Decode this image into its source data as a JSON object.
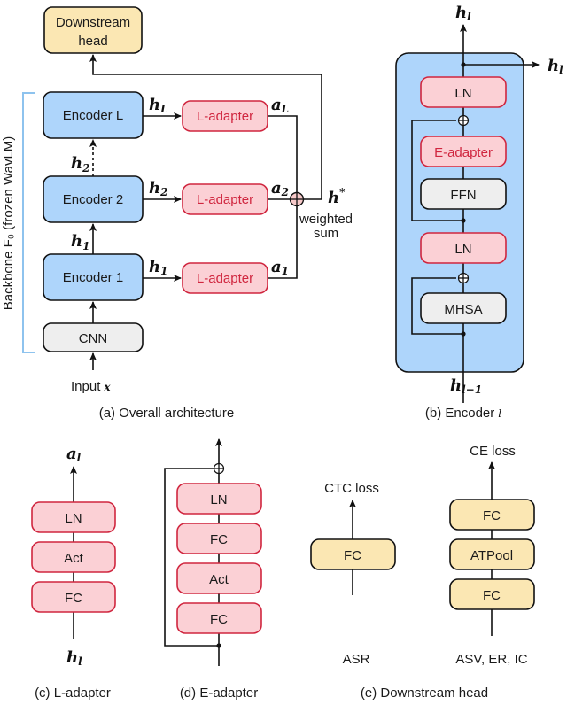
{
  "panel_a": {
    "caption": "(a) Overall architecture",
    "backbone_label": "Backbone F₀ (frozen WavLM)",
    "downstream_head_line1": "Downstream",
    "downstream_head_line2": "head",
    "encoders": [
      "Encoder L",
      "Encoder 2",
      "Encoder 1"
    ],
    "cnn": "CNN",
    "input_label": "Input",
    "input_var": "x",
    "l_adapter": "L-adapter",
    "h_labels": [
      "h",
      "h",
      "h",
      "h",
      "h"
    ],
    "h_subs": [
      "L",
      "2",
      "1",
      "2",
      "1"
    ],
    "a_labels": [
      "a",
      "a",
      "a"
    ],
    "a_subs": [
      "L",
      "2",
      "1"
    ],
    "h_star": "h",
    "h_star_sup": "*",
    "weighted_line1": "weighted",
    "weighted_line2": "sum"
  },
  "panel_b": {
    "caption_prefix": "(b) Encoder",
    "caption_var": "l",
    "blocks": [
      "LN",
      "E-adapter",
      "FFN",
      "LN",
      "MHSA"
    ],
    "out_top": "h",
    "out_top_sub": "l",
    "out_right": "h",
    "out_right_sub": "l",
    "in_bottom": "h",
    "in_bottom_sub": "l−1"
  },
  "panel_c": {
    "caption": "(c) L-adapter",
    "blocks": [
      "LN",
      "Act",
      "FC"
    ],
    "out": "a",
    "out_sub": "l",
    "in": "h",
    "in_sub": "l"
  },
  "panel_d": {
    "caption": "(d) E-adapter",
    "blocks": [
      "LN",
      "FC",
      "Act",
      "FC"
    ]
  },
  "panel_e": {
    "caption": "(e) Downstream head",
    "asr": {
      "loss": "CTC loss",
      "blocks": [
        "FC"
      ],
      "task": "ASR"
    },
    "cls": {
      "loss": "CE loss",
      "blocks": [
        "FC",
        "ATPool",
        "FC"
      ],
      "task": "ASV, ER, IC"
    }
  },
  "colors": {
    "encoder_fill": "#aed5fb",
    "adapter_fill": "#fbd0d5",
    "adapter_stroke": "#d0263f",
    "head_fill": "#fbe7b3",
    "gray_fill": "#eeeeee",
    "bracket": "#8ec3ee"
  }
}
